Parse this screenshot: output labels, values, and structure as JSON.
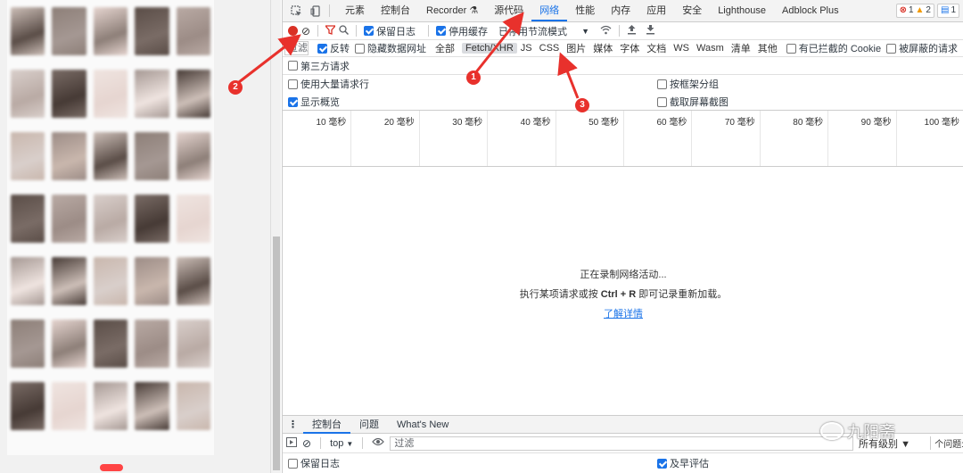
{
  "devtools": {
    "tabs": [
      "元素",
      "控制台",
      "Recorder",
      "源代码",
      "网络",
      "性能",
      "内存",
      "应用",
      "安全",
      "Lighthouse",
      "Adblock Plus"
    ],
    "active_tab": "网络",
    "badges": {
      "errors": "1",
      "warnings": "2",
      "messages": "1"
    }
  },
  "network_toolbar": {
    "preserve_log": "保留日志",
    "disable_cache": "停用缓存",
    "throttle": "已停用节流模式",
    "throttle_arrow": "▼"
  },
  "filter": {
    "placeholder": "过滤",
    "invert": "反转",
    "hide_data_urls": "隐藏数据网址",
    "types": [
      "全部",
      "Fetch/XHR",
      "JS",
      "CSS",
      "图片",
      "媒体",
      "字体",
      "文档",
      "WS",
      "Wasm",
      "清单",
      "其他"
    ],
    "selected_type": "Fetch/XHR",
    "blocked_cookies": "有已拦截的 Cookie",
    "blocked_requests": "被屏蔽的请求",
    "third_party": "第三方请求"
  },
  "options": {
    "large_rows": "使用大量请求行",
    "group_by_frame": "按框架分组",
    "show_overview": "显示概览",
    "capture_screenshots": "截取屏幕截图"
  },
  "timeline": {
    "ticks": [
      "10 毫秒",
      "20 毫秒",
      "30 毫秒",
      "40 毫秒",
      "50 毫秒",
      "60 毫秒",
      "70 毫秒",
      "80 毫秒",
      "90 毫秒",
      "100 毫秒"
    ]
  },
  "empty_state": {
    "line1": "正在录制网络活动...",
    "line2_pre": "执行某项请求或按",
    "line2_key": "Ctrl + R",
    "line2_post": "即可记录重新加载。",
    "link": "了解详情"
  },
  "drawer": {
    "tabs": [
      "控制台",
      "问题",
      "What's New"
    ],
    "context": "top",
    "context_arrow": "▼",
    "filter_placeholder": "过滤",
    "levels": "所有级别 ▼",
    "issues": "个问题:",
    "preserve_log": "保留日志",
    "eager_eval": "及早评估"
  },
  "annotations": [
    "1",
    "2",
    "3"
  ],
  "watermark": "九阳斋",
  "colors": {
    "accent": "#1a73e8",
    "record": "#d93025",
    "annotation": "#e8312c"
  }
}
